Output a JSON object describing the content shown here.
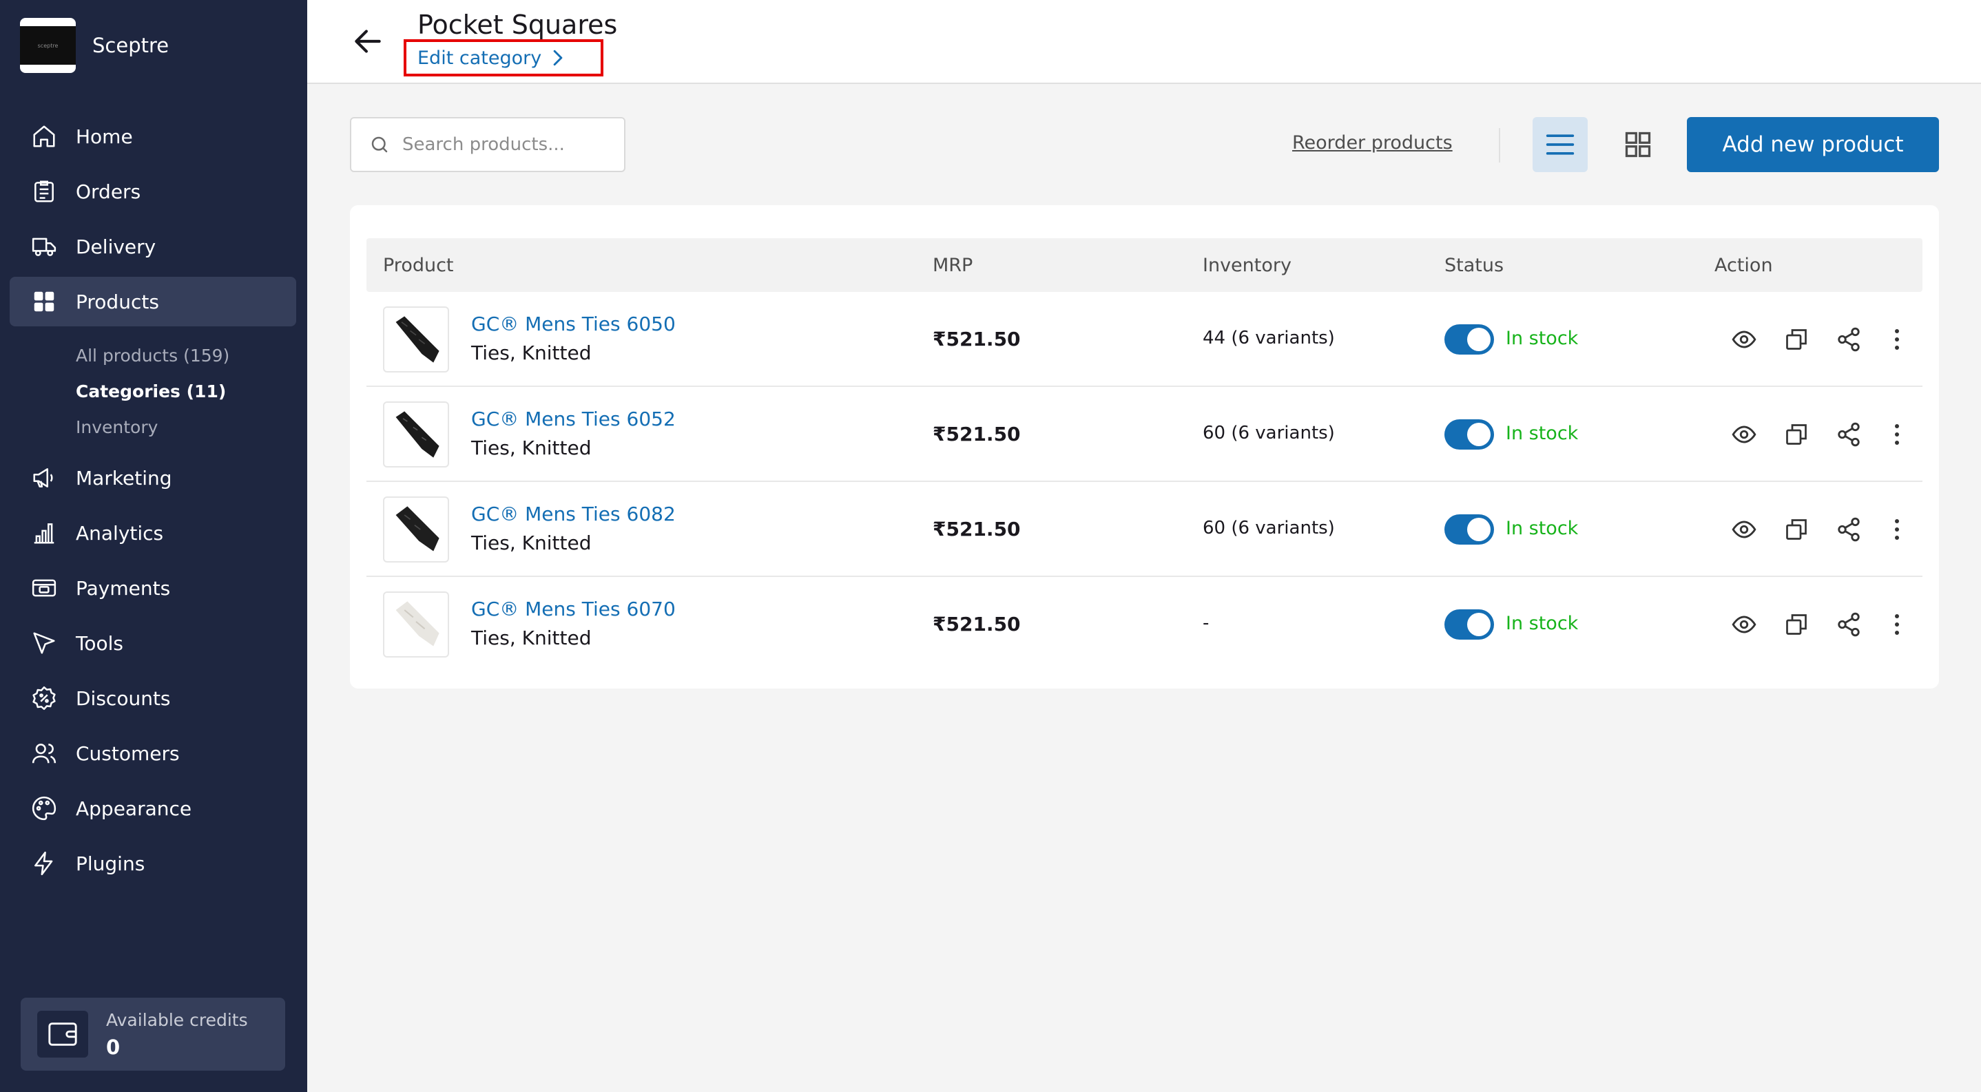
{
  "brand": {
    "name": "Sceptre",
    "logo_text": "sceptre"
  },
  "sidebar": {
    "items": [
      {
        "label": "Home",
        "icon": "home-icon"
      },
      {
        "label": "Orders",
        "icon": "orders-icon"
      },
      {
        "label": "Delivery",
        "icon": "truck-icon"
      },
      {
        "label": "Products",
        "icon": "grid-icon"
      },
      {
        "label": "Marketing",
        "icon": "megaphone-icon"
      },
      {
        "label": "Analytics",
        "icon": "bar-chart-icon"
      },
      {
        "label": "Payments",
        "icon": "payments-icon"
      },
      {
        "label": "Tools",
        "icon": "cursor-icon"
      },
      {
        "label": "Discounts",
        "icon": "discount-badge-icon"
      },
      {
        "label": "Customers",
        "icon": "users-icon"
      },
      {
        "label": "Appearance",
        "icon": "palette-icon"
      },
      {
        "label": "Plugins",
        "icon": "lightning-icon"
      }
    ],
    "sub_items": [
      {
        "label": "All products (159)"
      },
      {
        "label": "Categories (11)"
      },
      {
        "label": "Inventory"
      }
    ],
    "active_item": "Products",
    "active_sub_item": "Categories (11)"
  },
  "credits": {
    "label": "Available credits",
    "value": "0"
  },
  "header": {
    "title": "Pocket Squares",
    "edit_link": "Edit category"
  },
  "toolbar": {
    "search_placeholder": "Search products...",
    "reorder_label": "Reorder products",
    "add_label": "Add new product"
  },
  "table": {
    "columns": [
      "Product",
      "MRP",
      "Inventory",
      "Status",
      "Action"
    ],
    "rows": [
      {
        "name": "GC® Mens Ties 6050",
        "category": "Ties, Knitted",
        "mrp": "₹521.50",
        "inventory": "44 (6 variants)",
        "status": "In stock",
        "thumb": "dark-tie"
      },
      {
        "name": "GC® Mens Ties 6052",
        "category": "Ties, Knitted",
        "mrp": "₹521.50",
        "inventory": "60 (6 variants)",
        "status": "In stock",
        "thumb": "dark-tie"
      },
      {
        "name": "GC® Mens Ties 6082",
        "category": "Ties, Knitted",
        "mrp": "₹521.50",
        "inventory": "60 (6 variants)",
        "status": "In stock",
        "thumb": "dark-tie"
      },
      {
        "name": "GC® Mens Ties 6070",
        "category": "Ties, Knitted",
        "mrp": "₹521.50",
        "inventory": "-",
        "status": "In stock",
        "thumb": "light-tie"
      }
    ]
  },
  "colors": {
    "sidebar_bg": "#1e2640",
    "sidebar_active": "#353e5a",
    "accent": "#146eb4",
    "in_stock": "#17b31b",
    "highlight_box": "#e60000"
  }
}
